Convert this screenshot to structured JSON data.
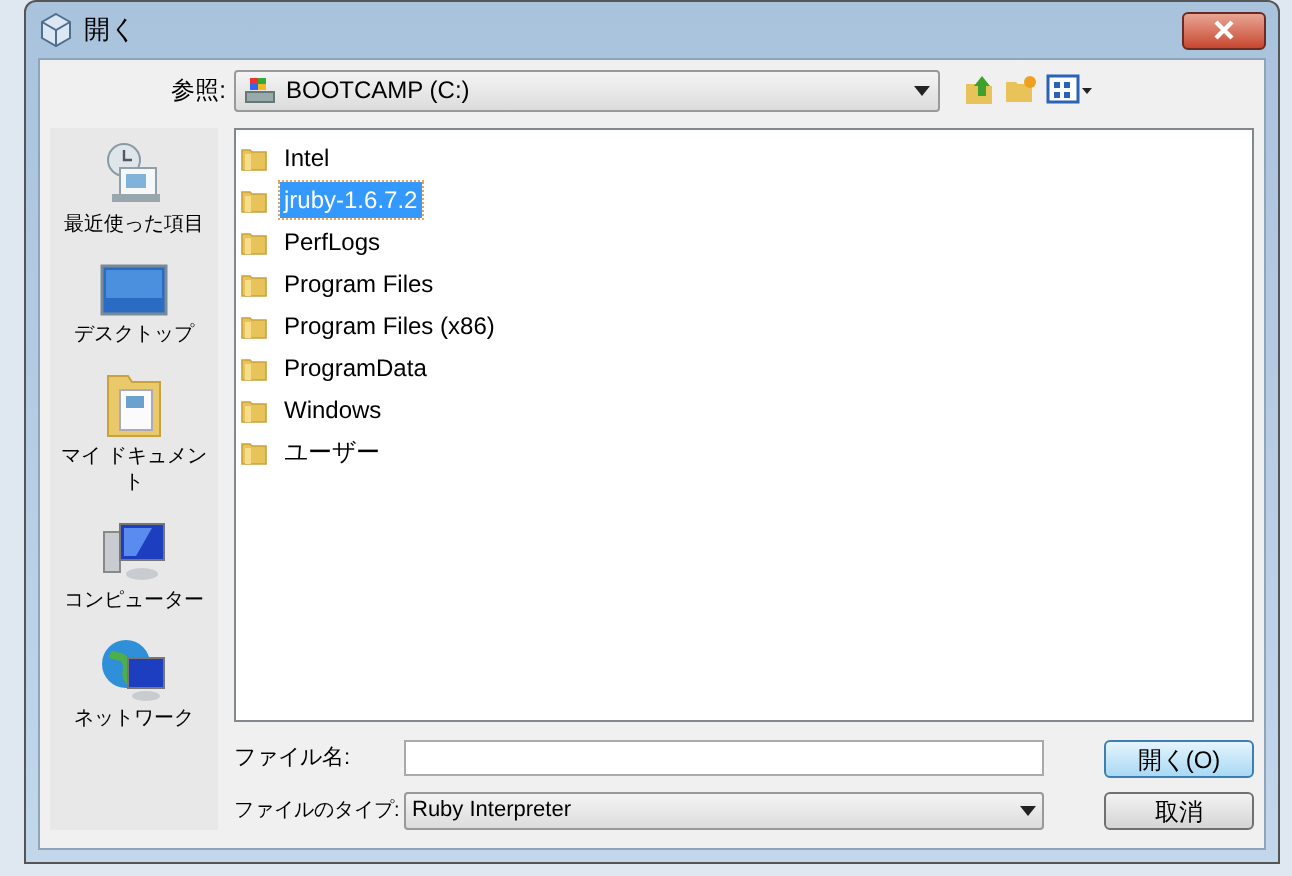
{
  "window": {
    "title": "開く"
  },
  "toolbar": {
    "label": "参照:",
    "location": "BOOTCAMP (C:)"
  },
  "sidebar": {
    "items": [
      {
        "kind": "recent",
        "label": "最近使った項目"
      },
      {
        "kind": "desktop",
        "label": "デスクトップ"
      },
      {
        "kind": "documents",
        "label": "マイ ドキュメント"
      },
      {
        "kind": "computer",
        "label": "コンピューター"
      },
      {
        "kind": "network",
        "label": "ネットワーク"
      }
    ]
  },
  "files": [
    {
      "name": "Intel",
      "selected": false
    },
    {
      "name": "jruby-1.6.7.2",
      "selected": true
    },
    {
      "name": "PerfLogs",
      "selected": false
    },
    {
      "name": "Program Files",
      "selected": false
    },
    {
      "name": "Program Files (x86)",
      "selected": false
    },
    {
      "name": "ProgramData",
      "selected": false
    },
    {
      "name": "Windows",
      "selected": false
    },
    {
      "name": "ユーザー",
      "selected": false
    }
  ],
  "filename": {
    "label": "ファイル名:"
  },
  "filetype": {
    "label": "ファイルのタイプ:",
    "value": "Ruby Interpreter"
  },
  "buttons": [
    "開く(O)",
    "取消"
  ]
}
